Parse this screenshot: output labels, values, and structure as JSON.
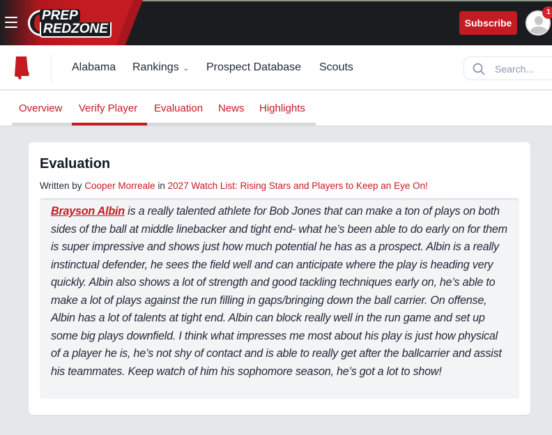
{
  "header": {
    "menu_icon": "hamburger-icon",
    "logo": {
      "line1": "PREP",
      "line2": "REDZONE"
    },
    "subscribe_label": "Subscribe",
    "avatar_icon": "user-avatar-icon",
    "notification_count": "1",
    "colors": {
      "brand_red": "#c41a22",
      "topbar_bg": "#1b1c1f"
    }
  },
  "subnav": {
    "state_icon": "alabama-state-icon",
    "links": [
      {
        "label": "Alabama"
      },
      {
        "label": "Rankings",
        "has_dropdown": true,
        "dropdown_icon": "chevron-down-icon"
      },
      {
        "label": "Prospect Database"
      },
      {
        "label": "Scouts"
      }
    ],
    "search": {
      "placeholder": "Search...",
      "value": "",
      "icon": "search-icon"
    }
  },
  "tabs": {
    "items": [
      {
        "label": "Overview"
      },
      {
        "label": "Verify Player",
        "active": true
      },
      {
        "label": "Evaluation"
      },
      {
        "label": "News"
      },
      {
        "label": "Highlights"
      }
    ]
  },
  "evaluation": {
    "title": "Evaluation",
    "byline_prefix": "Written by",
    "author": "Cooper Morreale",
    "byline_in": "in",
    "article": "2027 Watch List: Rising Stars and Players to Keep an Eye On!",
    "player_name": "Brayson Albin",
    "body": " is a really talented athlete for Bob Jones that can make a ton of plays on both sides of the ball at middle linebacker and tight end- what he’s been able to do early on for them is super impressive and shows just how much potential he has as a prospect. Albin is a really instinctual defender, he sees the field well and can anticipate where the play is heading very quickly. Albin also shows a lot of strength and good tackling techniques early on, he’s able to make a lot of plays against the run filling in gaps/bringing down the ball carrier. On offense, Albin has a lot of talents at tight end. Albin can block really well in the run game and set up some big plays downfield. I think what impresses me most about his play is just how physical of a player he is, he’s not shy of contact and is able to really get after the ballcarrier and assist his teammates. Keep watch of him his sophomore season, he’s got a lot to show!"
  }
}
